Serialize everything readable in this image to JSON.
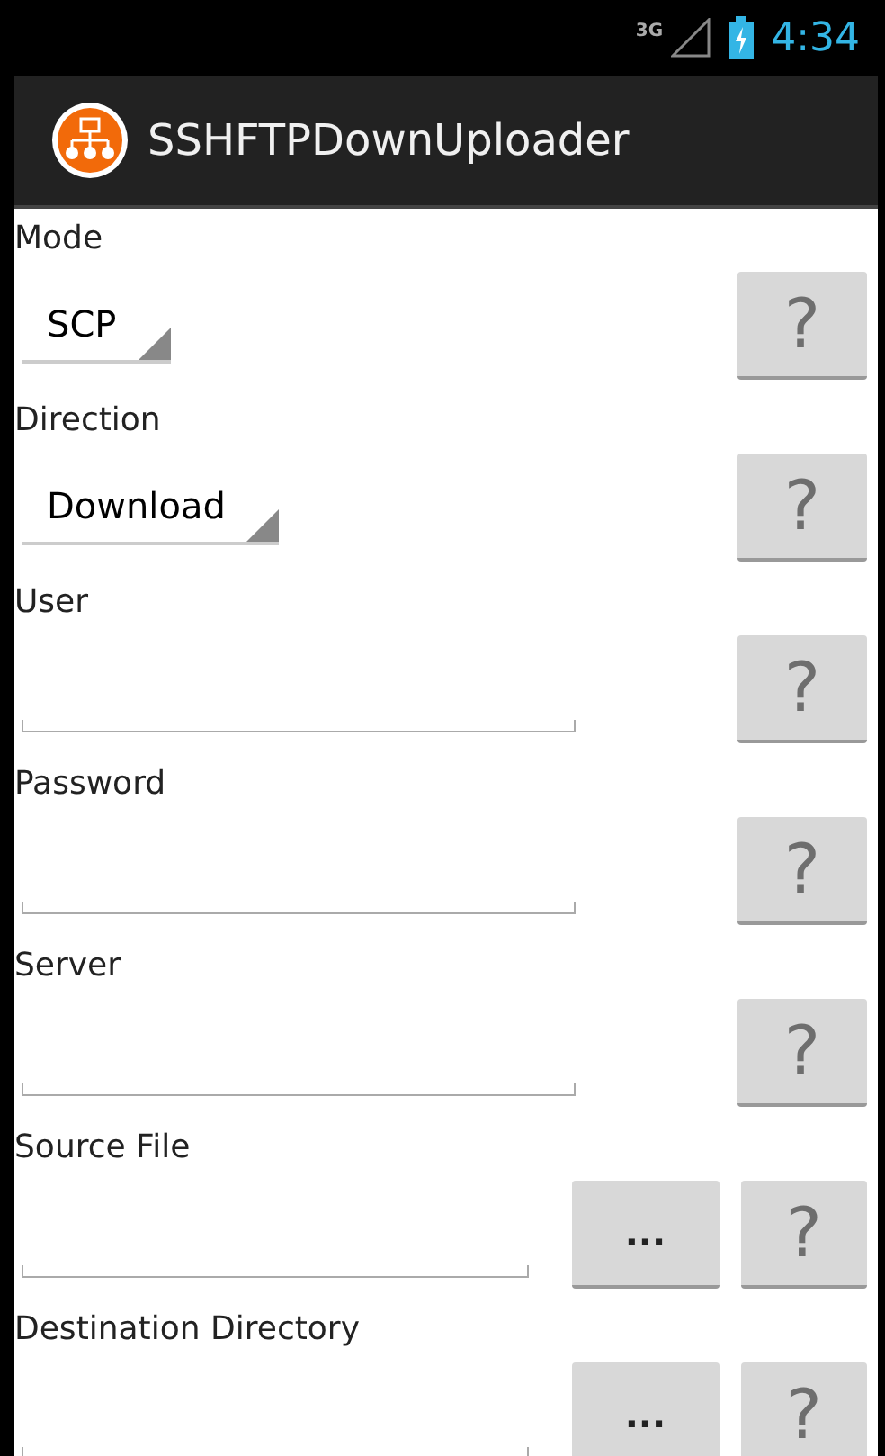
{
  "status_bar": {
    "network": "3G",
    "time": "4:34"
  },
  "action_bar": {
    "title": "SSHFTPDownUploader"
  },
  "rows": [
    {
      "kind": "spinner",
      "label": "Mode",
      "value": "SCP",
      "help": "?"
    },
    {
      "kind": "spinner",
      "label": "Direction",
      "value": "Download",
      "help": "?"
    },
    {
      "kind": "text",
      "label": "User",
      "help": "?"
    },
    {
      "kind": "text",
      "label": "Password",
      "help": "?"
    },
    {
      "kind": "text",
      "label": "Server",
      "help": "?"
    },
    {
      "kind": "file",
      "label": "Source File",
      "browse": "...",
      "help": "?"
    },
    {
      "kind": "file",
      "label": "Destination Directory",
      "browse": "...",
      "help": "?"
    }
  ]
}
